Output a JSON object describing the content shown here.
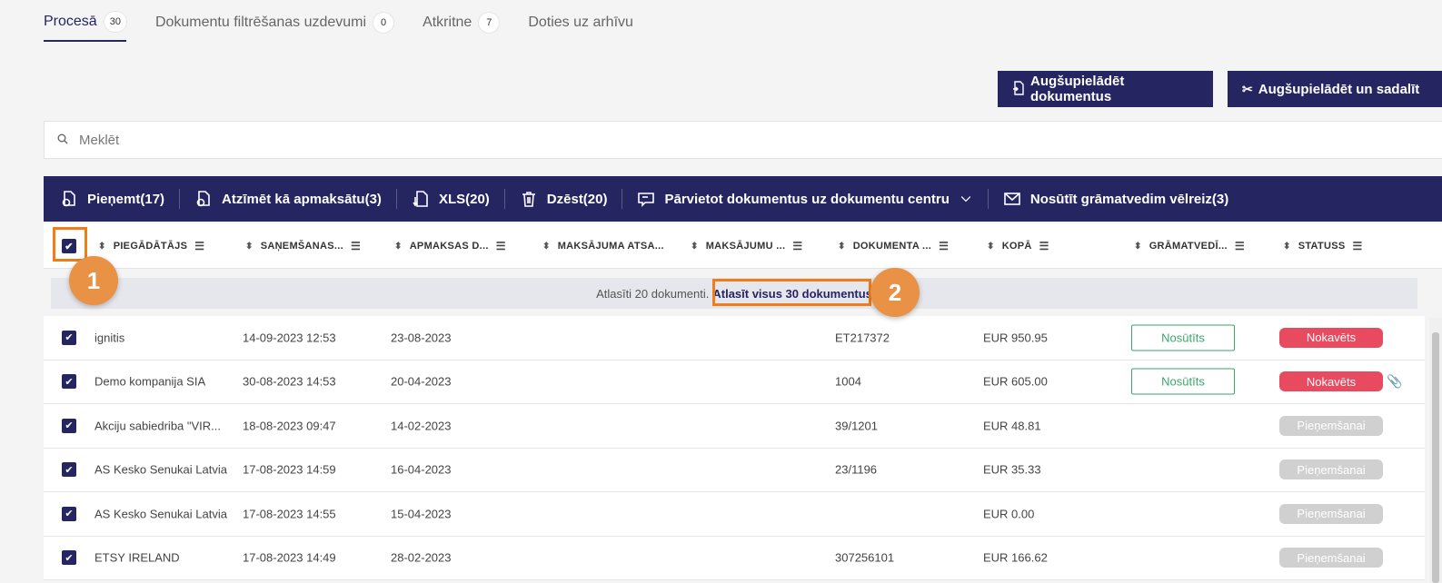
{
  "tabs": [
    {
      "label": "Procesā",
      "count": "30"
    },
    {
      "label": "Dokumentu filtrēšanas uzdevumi",
      "count": "0"
    },
    {
      "label": "Atkritne",
      "count": "7"
    },
    {
      "label": "Doties uz arhīvu",
      "count": ""
    }
  ],
  "buttons": {
    "upload": "Augšupielādēt dokumentus",
    "upload_split": "Augšupielādēt un sadalīt"
  },
  "search": {
    "placeholder": "Meklēt"
  },
  "actions": [
    {
      "label": "Pieņemt(17)",
      "icon": "accept-icon"
    },
    {
      "label": "Atzīmēt kā apmaksātu(3)",
      "icon": "mark-paid-icon"
    },
    {
      "label": "XLS(20)",
      "icon": "xls-download-icon"
    },
    {
      "label": "Dzēst(20)",
      "icon": "trash-icon"
    },
    {
      "label": "Pārvietot dokumentus uz dokumentu centru",
      "icon": "move-document-icon"
    },
    {
      "label": "Nosūtīt grāmatvedim vēlreiz(3)",
      "icon": "mail-icon"
    }
  ],
  "columns": [
    "PIEGĀDĀTĀJS",
    "SAŅEMŠANAS...",
    "APMAKSAS D...",
    "MAKSĀJUMA ATSA...",
    "MAKSĀJUMU ...",
    "DOKUMENTA ...",
    "KOPĀ",
    "GRĀMATVEDĪ...",
    "STATUSS"
  ],
  "selection": {
    "text": "Atlasīti 20 dokumenti.",
    "link": "Atlasīt visus 30 dokumentus"
  },
  "rows": [
    {
      "supplier": "ignitis",
      "received": "14-09-2023 12:53",
      "due": "23-08-2023",
      "doc": "ET217372",
      "total": "EUR 950.95",
      "accountant": "Nosūtīts",
      "status": "Nokavēts",
      "attachment": false
    },
    {
      "supplier": "Demo kompanija SIA",
      "received": "30-08-2023 14:53",
      "due": "20-04-2023",
      "doc": "1004",
      "total": "EUR 605.00",
      "accountant": "Nosūtīts",
      "status": "Nokavēts",
      "attachment": true
    },
    {
      "supplier": "Akciju sabiedriba \"VIR...",
      "received": "18-08-2023 09:47",
      "due": "14-02-2023",
      "doc": "39/1201",
      "total": "EUR 48.81",
      "accountant": "",
      "status": "Pieņemšanai",
      "attachment": false
    },
    {
      "supplier": "AS Kesko Senukai Latvia",
      "received": "17-08-2023 14:59",
      "due": "16-04-2023",
      "doc": "23/1196",
      "total": "EUR 35.33",
      "accountant": "",
      "status": "Pieņemšanai",
      "attachment": false
    },
    {
      "supplier": "AS Kesko Senukai Latvia",
      "received": "17-08-2023 14:55",
      "due": "15-04-2023",
      "doc": "",
      "total": "EUR 0.00",
      "accountant": "",
      "status": "Pieņemšanai",
      "attachment": false
    },
    {
      "supplier": "ETSY IRELAND",
      "received": "17-08-2023 14:49",
      "due": "28-02-2023",
      "doc": "307256101",
      "total": "EUR 166.62",
      "accountant": "",
      "status": "Pieņemšanai",
      "attachment": false
    }
  ],
  "annotations": {
    "marker1": "1",
    "marker2": "2"
  },
  "colors": {
    "brand": "#252562",
    "overdue": "#e84a5f",
    "pending": "#d0d0d0",
    "sent": "#3aa66a",
    "highlight": "#f07d1a",
    "marker": "#e99144"
  }
}
